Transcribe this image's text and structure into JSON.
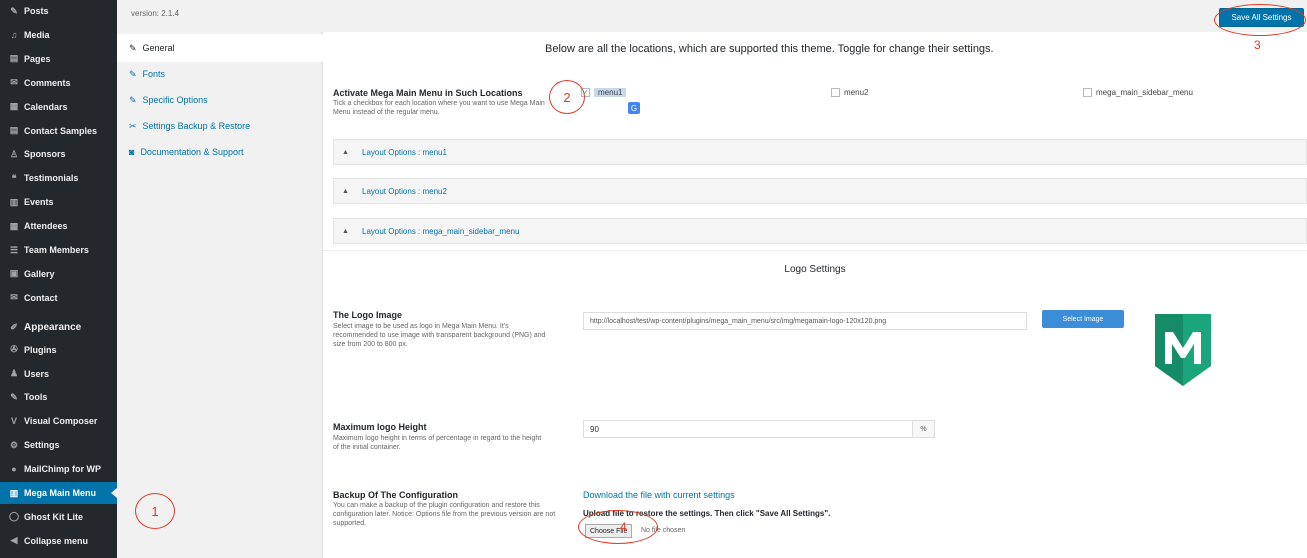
{
  "admin_menu": [
    {
      "icon": "pin-icon",
      "glyph": "✎",
      "label": "Posts"
    },
    {
      "icon": "media-icon",
      "glyph": "♫",
      "label": "Media"
    },
    {
      "icon": "pages-icon",
      "glyph": "▤",
      "label": "Pages"
    },
    {
      "icon": "comments-icon",
      "glyph": "✉",
      "label": "Comments"
    },
    {
      "icon": "calendar-icon",
      "glyph": "▦",
      "label": "Calendars"
    },
    {
      "icon": "contact-icon",
      "glyph": "▤",
      "label": "Contact Samples"
    },
    {
      "icon": "sponsors-icon",
      "glyph": "♙",
      "label": "Sponsors"
    },
    {
      "icon": "testimonials-icon",
      "glyph": "❝",
      "label": "Testimonials"
    },
    {
      "icon": "events-icon",
      "glyph": "▥",
      "label": "Events"
    },
    {
      "icon": "attendees-icon",
      "glyph": "▦",
      "label": "Attendees"
    },
    {
      "icon": "team-icon",
      "glyph": "☰",
      "label": "Team Members"
    },
    {
      "icon": "gallery-icon",
      "glyph": "▣",
      "label": "Gallery"
    },
    {
      "icon": "contact-form-icon",
      "glyph": "✉",
      "label": "Contact"
    },
    {
      "icon": "appearance-icon",
      "glyph": "✐",
      "label": "Appearance"
    },
    {
      "icon": "plugins-icon",
      "glyph": "✇",
      "label": "Plugins"
    },
    {
      "icon": "users-icon",
      "glyph": "♟",
      "label": "Users"
    },
    {
      "icon": "tools-icon",
      "glyph": "✎",
      "label": "Tools"
    },
    {
      "icon": "composer-icon",
      "glyph": "V",
      "label": "Visual Composer"
    },
    {
      "icon": "settings-icon",
      "glyph": "⚙",
      "label": "Settings"
    },
    {
      "icon": "mailchimp-icon",
      "glyph": "●",
      "label": "MailChimp for WP"
    },
    {
      "icon": "mega-menu-icon",
      "glyph": "▥",
      "label": "Mega Main Menu"
    },
    {
      "icon": "ghost-icon",
      "glyph": "◯",
      "label": "Ghost Kit Lite"
    },
    {
      "icon": "collapse-icon",
      "glyph": "◀",
      "label": "Collapse menu"
    }
  ],
  "top": {
    "version": "version: 2.1.4",
    "save_all": "Save All Settings"
  },
  "plugin_nav": [
    {
      "icon": "general-icon",
      "glyph": "✎",
      "label": "General"
    },
    {
      "icon": "fonts-icon",
      "glyph": "✎",
      "label": "Fonts"
    },
    {
      "icon": "specific-icon",
      "glyph": "✎",
      "label": "Specific Options"
    },
    {
      "icon": "settings-backup-icon",
      "glyph": "✂",
      "label": "Settings Backup & Restore"
    },
    {
      "icon": "docs-icon",
      "glyph": "◙",
      "label": "Documentation & Support"
    }
  ],
  "content": {
    "intro": "Below are all the locations, which are supported this theme. Toggle for change their settings.",
    "activate": {
      "label": "Activate Mega Main Menu in Such Locations",
      "desc": "Tick a checkbox for each location where you want to use Mega Main Menu instead of the regular menu.",
      "locations": [
        "menu1",
        "menu2",
        "mega_main_sidebar_menu"
      ]
    },
    "accordions": [
      "Layout Options : menu1",
      "Layout Options : menu2",
      "Layout Options : mega_main_sidebar_menu"
    ],
    "section_title": "Logo Settings",
    "logo": {
      "label": "The Logo Image",
      "desc": "Select image to be used as logo in Mega Main Menu. It's recommended to use image with transparent background (PNG) and size from 200 to 800 px.",
      "path": "http://localhost/test/wp-content/plugins/mega_main_menu/src/img/megamain-logo-120x120.png",
      "button": "Select Image"
    },
    "height": {
      "label": "Maximum logo Height",
      "desc": "Maximum logo height in terms of percentage in regard to the height of the initial container.",
      "value": "90",
      "unit": "%"
    },
    "backup": {
      "label": "Backup Of The Configuration",
      "desc": "You can make a backup of the plugin configuration and restore this configuration later. Notice: Options file from the previous version are not supported.",
      "download_link": "Download the file with current settings",
      "note": "Upload file to restore the settings. Then click \"Save All Settings\".",
      "file_button": "Choose File",
      "file_none": "No file chosen"
    }
  },
  "callouts": [
    "1",
    "2",
    "3",
    "4"
  ],
  "colors": {
    "sidebar": "#23282d",
    "accent": "#0073aa",
    "callout": "#e03b24",
    "logo_green": "#1aa57a"
  }
}
